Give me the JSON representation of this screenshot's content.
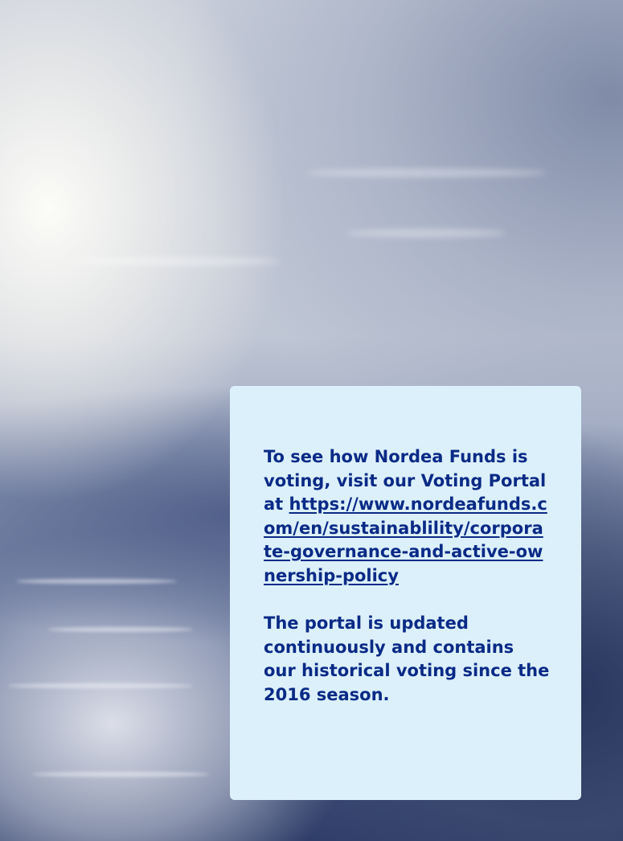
{
  "info_card": {
    "intro_text": "To see how Nordea Funds is voting, visit our Voting Portal at ",
    "portal_url": "https://www.nordeafunds.com/en/sustainablility/corporate-governance-and-active-ownership-policy",
    "update_text": "The portal is updated continuously and contains our historical voting since the 2016 season."
  },
  "colors": {
    "card_background": "#dcf0fb",
    "text": "#0a2a86"
  }
}
